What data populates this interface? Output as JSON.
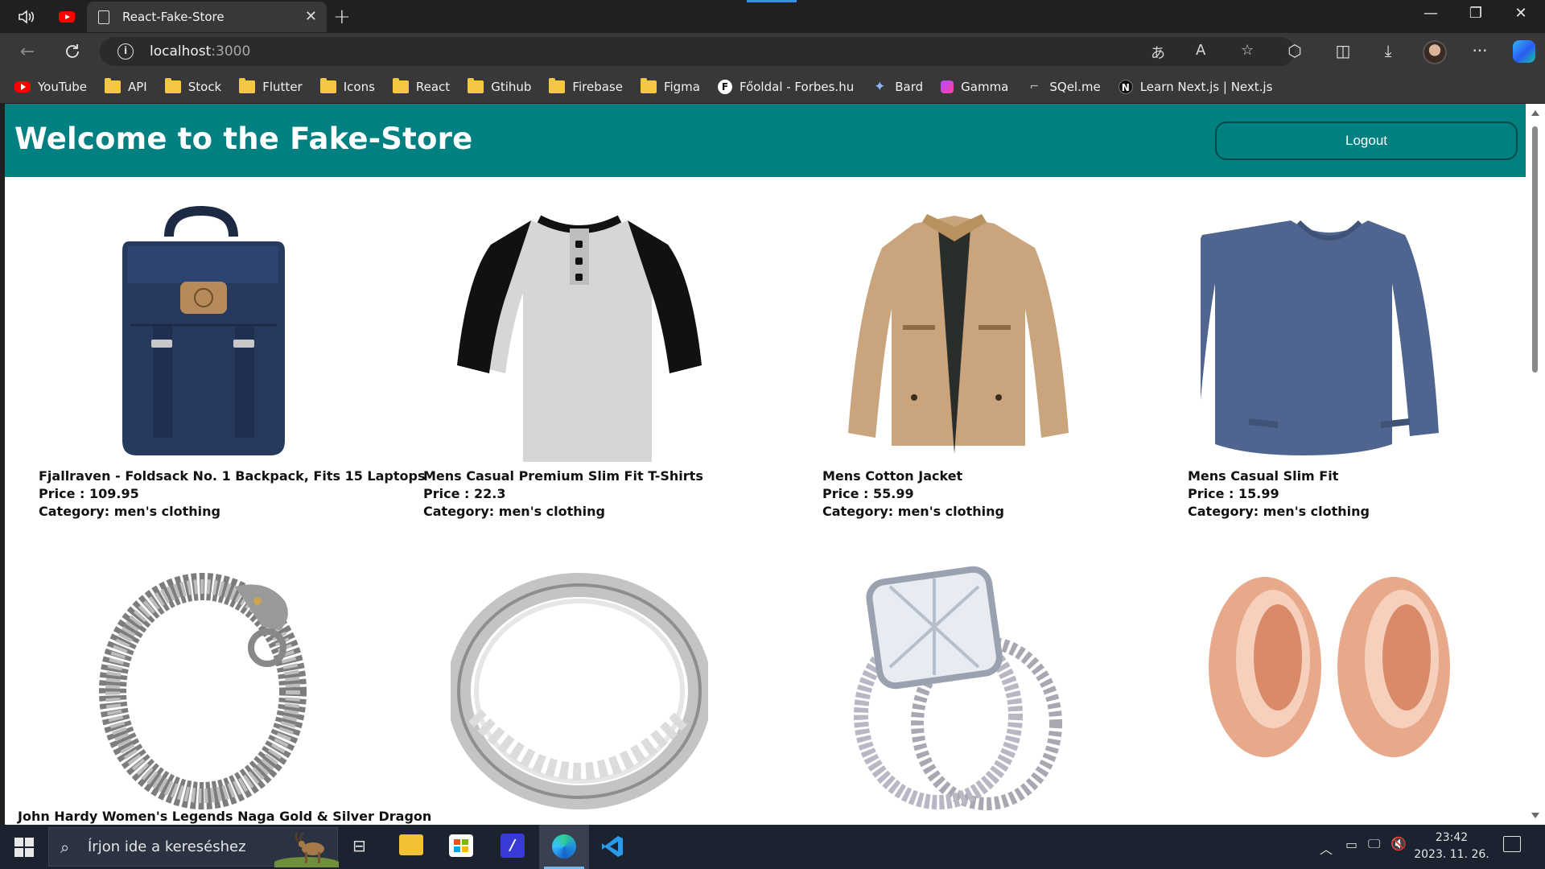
{
  "browser": {
    "tab_title": "React-Fake-Store",
    "url_host": "localhost",
    "url_port": ":3000"
  },
  "bookmarks": [
    {
      "label": "YouTube",
      "icon": "youtube-icon"
    },
    {
      "label": "API",
      "icon": "folder-icon"
    },
    {
      "label": "Stock",
      "icon": "folder-icon"
    },
    {
      "label": "Flutter",
      "icon": "folder-icon"
    },
    {
      "label": "Icons",
      "icon": "folder-icon"
    },
    {
      "label": "React",
      "icon": "folder-icon"
    },
    {
      "label": "Gtihub",
      "icon": "folder-icon"
    },
    {
      "label": "Firebase",
      "icon": "folder-icon"
    },
    {
      "label": "Figma",
      "icon": "folder-icon"
    },
    {
      "label": "Főoldal - Forbes.hu",
      "icon": "forbes-icon"
    },
    {
      "label": "Bard",
      "icon": "bard-icon"
    },
    {
      "label": "Gamma",
      "icon": "gamma-icon"
    },
    {
      "label": "SQel.me",
      "icon": "sqel-icon"
    },
    {
      "label": "Learn Next.js | Next.js",
      "icon": "nextjs-icon"
    }
  ],
  "store": {
    "title": "Welcome to the Fake-Store",
    "logout_label": "Logout",
    "accent_color": "#008080"
  },
  "products": [
    {
      "title": "Fjallraven - Foldsack No. 1 Backpack, Fits 15 Laptops",
      "price": "Price : 109.95",
      "category": "Category: men's clothing",
      "image": "backpack"
    },
    {
      "title": "Mens Casual Premium Slim Fit T-Shirts",
      "price": "Price : 22.3",
      "category": "Category: men's clothing",
      "image": "tshirt"
    },
    {
      "title": "Mens Cotton Jacket",
      "price": "Price : 55.99",
      "category": "Category: men's clothing",
      "image": "jacket"
    },
    {
      "title": "Mens Casual Slim Fit",
      "price": "Price : 15.99",
      "category": "Category: men's clothing",
      "image": "longsleeve"
    },
    {
      "title": "John Hardy Women's Legends Naga Gold & Silver Dragon",
      "image": "bracelet"
    },
    {
      "image": "silver-ring"
    },
    {
      "image": "diamond-ring"
    },
    {
      "image": "rose-gold-tunnels"
    }
  ],
  "taskbar": {
    "search_placeholder": "Írjon ide a kereséshez",
    "time": "23:42",
    "date": "2023. 11. 26."
  }
}
